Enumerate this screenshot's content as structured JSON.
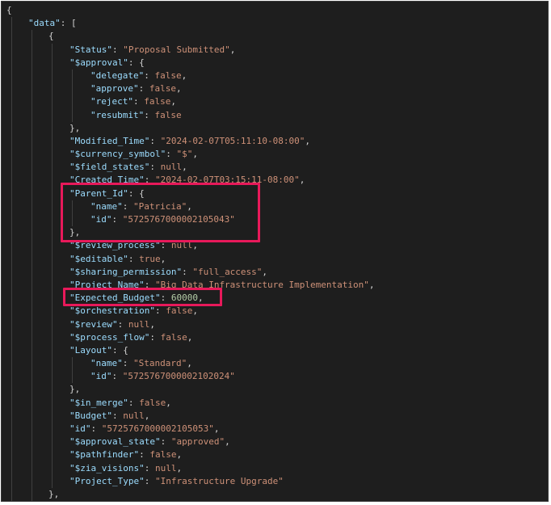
{
  "editor": {
    "lines": [
      {
        "indent": 0,
        "tokens": [
          {
            "t": "{",
            "c": "punc"
          }
        ]
      },
      {
        "indent": 1,
        "tokens": [
          {
            "t": "\"data\"",
            "c": "key"
          },
          {
            "t": ": [",
            "c": "punc"
          }
        ]
      },
      {
        "indent": 2,
        "tokens": [
          {
            "t": "{",
            "c": "punc"
          }
        ]
      },
      {
        "indent": 3,
        "tokens": [
          {
            "t": "\"Status\"",
            "c": "key"
          },
          {
            "t": ": ",
            "c": "punc"
          },
          {
            "t": "\"Proposal Submitted\"",
            "c": "str"
          },
          {
            "t": ",",
            "c": "punc"
          }
        ]
      },
      {
        "indent": 3,
        "tokens": [
          {
            "t": "\"$approval\"",
            "c": "key"
          },
          {
            "t": ": {",
            "c": "punc"
          }
        ]
      },
      {
        "indent": 4,
        "tokens": [
          {
            "t": "\"delegate\"",
            "c": "key"
          },
          {
            "t": ": ",
            "c": "punc"
          },
          {
            "t": "false",
            "c": "kw"
          },
          {
            "t": ",",
            "c": "punc"
          }
        ]
      },
      {
        "indent": 4,
        "tokens": [
          {
            "t": "\"approve\"",
            "c": "key"
          },
          {
            "t": ": ",
            "c": "punc"
          },
          {
            "t": "false",
            "c": "kw"
          },
          {
            "t": ",",
            "c": "punc"
          }
        ]
      },
      {
        "indent": 4,
        "tokens": [
          {
            "t": "\"reject\"",
            "c": "key"
          },
          {
            "t": ": ",
            "c": "punc"
          },
          {
            "t": "false",
            "c": "kw"
          },
          {
            "t": ",",
            "c": "punc"
          }
        ]
      },
      {
        "indent": 4,
        "tokens": [
          {
            "t": "\"resubmit\"",
            "c": "key"
          },
          {
            "t": ": ",
            "c": "punc"
          },
          {
            "t": "false",
            "c": "kw"
          }
        ]
      },
      {
        "indent": 3,
        "tokens": [
          {
            "t": "},",
            "c": "punc"
          }
        ]
      },
      {
        "indent": 3,
        "tokens": [
          {
            "t": "\"Modified_Time\"",
            "c": "key"
          },
          {
            "t": ": ",
            "c": "punc"
          },
          {
            "t": "\"2024-02-07T05:11:10-08:00\"",
            "c": "str"
          },
          {
            "t": ",",
            "c": "punc"
          }
        ]
      },
      {
        "indent": 3,
        "tokens": [
          {
            "t": "\"$currency_symbol\"",
            "c": "key"
          },
          {
            "t": ": ",
            "c": "punc"
          },
          {
            "t": "\"$\"",
            "c": "str"
          },
          {
            "t": ",",
            "c": "punc"
          }
        ]
      },
      {
        "indent": 3,
        "tokens": [
          {
            "t": "\"$field_states\"",
            "c": "key"
          },
          {
            "t": ": ",
            "c": "punc"
          },
          {
            "t": "null",
            "c": "kw"
          },
          {
            "t": ",",
            "c": "punc"
          }
        ]
      },
      {
        "indent": 3,
        "tokens": [
          {
            "t": "\"Created_Time\"",
            "c": "key"
          },
          {
            "t": ": ",
            "c": "punc"
          },
          {
            "t": "\"2024-02-07T03:15:11-08:00\"",
            "c": "str"
          },
          {
            "t": ",",
            "c": "punc"
          }
        ]
      },
      {
        "indent": 3,
        "tokens": [
          {
            "t": "\"Parent_Id\"",
            "c": "key"
          },
          {
            "t": ": {",
            "c": "punc"
          }
        ]
      },
      {
        "indent": 4,
        "tokens": [
          {
            "t": "\"name\"",
            "c": "key"
          },
          {
            "t": ": ",
            "c": "punc"
          },
          {
            "t": "\"Patricia\"",
            "c": "str"
          },
          {
            "t": ",",
            "c": "punc"
          }
        ]
      },
      {
        "indent": 4,
        "tokens": [
          {
            "t": "\"id\"",
            "c": "key"
          },
          {
            "t": ": ",
            "c": "punc"
          },
          {
            "t": "\"5725767000002105043\"",
            "c": "str"
          }
        ]
      },
      {
        "indent": 3,
        "tokens": [
          {
            "t": "},",
            "c": "punc"
          }
        ]
      },
      {
        "indent": 3,
        "tokens": [
          {
            "t": "\"$review_process\"",
            "c": "key"
          },
          {
            "t": ": ",
            "c": "punc"
          },
          {
            "t": "null",
            "c": "kw"
          },
          {
            "t": ",",
            "c": "punc"
          }
        ]
      },
      {
        "indent": 3,
        "tokens": [
          {
            "t": "\"$editable\"",
            "c": "key"
          },
          {
            "t": ": ",
            "c": "punc"
          },
          {
            "t": "true",
            "c": "kw"
          },
          {
            "t": ",",
            "c": "punc"
          }
        ]
      },
      {
        "indent": 3,
        "tokens": [
          {
            "t": "\"$sharing_permission\"",
            "c": "key"
          },
          {
            "t": ": ",
            "c": "punc"
          },
          {
            "t": "\"full_access\"",
            "c": "str"
          },
          {
            "t": ",",
            "c": "punc"
          }
        ]
      },
      {
        "indent": 3,
        "tokens": [
          {
            "t": "\"Project_Name\"",
            "c": "key"
          },
          {
            "t": ": ",
            "c": "punc"
          },
          {
            "t": "\"Big Data Infrastructure Implementation\"",
            "c": "str"
          },
          {
            "t": ",",
            "c": "punc"
          }
        ]
      },
      {
        "indent": 3,
        "tokens": [
          {
            "t": "\"Expected_Budget\"",
            "c": "key"
          },
          {
            "t": ": ",
            "c": "punc"
          },
          {
            "t": "60000",
            "c": "num"
          },
          {
            "t": ",",
            "c": "punc"
          }
        ]
      },
      {
        "indent": 3,
        "tokens": [
          {
            "t": "\"$orchestration\"",
            "c": "key"
          },
          {
            "t": ": ",
            "c": "punc"
          },
          {
            "t": "false",
            "c": "kw"
          },
          {
            "t": ",",
            "c": "punc"
          }
        ]
      },
      {
        "indent": 3,
        "tokens": [
          {
            "t": "\"$review\"",
            "c": "key"
          },
          {
            "t": ": ",
            "c": "punc"
          },
          {
            "t": "null",
            "c": "kw"
          },
          {
            "t": ",",
            "c": "punc"
          }
        ]
      },
      {
        "indent": 3,
        "tokens": [
          {
            "t": "\"$process_flow\"",
            "c": "key"
          },
          {
            "t": ": ",
            "c": "punc"
          },
          {
            "t": "false",
            "c": "kw"
          },
          {
            "t": ",",
            "c": "punc"
          }
        ]
      },
      {
        "indent": 3,
        "tokens": [
          {
            "t": "\"Layout\"",
            "c": "key"
          },
          {
            "t": ": {",
            "c": "punc"
          }
        ]
      },
      {
        "indent": 4,
        "tokens": [
          {
            "t": "\"name\"",
            "c": "key"
          },
          {
            "t": ": ",
            "c": "punc"
          },
          {
            "t": "\"Standard\"",
            "c": "str"
          },
          {
            "t": ",",
            "c": "punc"
          }
        ]
      },
      {
        "indent": 4,
        "tokens": [
          {
            "t": "\"id\"",
            "c": "key"
          },
          {
            "t": ": ",
            "c": "punc"
          },
          {
            "t": "\"5725767000002102024\"",
            "c": "str"
          }
        ]
      },
      {
        "indent": 3,
        "tokens": [
          {
            "t": "},",
            "c": "punc"
          }
        ]
      },
      {
        "indent": 3,
        "tokens": [
          {
            "t": "\"$in_merge\"",
            "c": "key"
          },
          {
            "t": ": ",
            "c": "punc"
          },
          {
            "t": "false",
            "c": "kw"
          },
          {
            "t": ",",
            "c": "punc"
          }
        ]
      },
      {
        "indent": 3,
        "tokens": [
          {
            "t": "\"Budget\"",
            "c": "key"
          },
          {
            "t": ": ",
            "c": "punc"
          },
          {
            "t": "null",
            "c": "kw"
          },
          {
            "t": ",",
            "c": "punc"
          }
        ]
      },
      {
        "indent": 3,
        "tokens": [
          {
            "t": "\"id\"",
            "c": "key"
          },
          {
            "t": ": ",
            "c": "punc"
          },
          {
            "t": "\"5725767000002105053\"",
            "c": "str"
          },
          {
            "t": ",",
            "c": "punc"
          }
        ]
      },
      {
        "indent": 3,
        "tokens": [
          {
            "t": "\"$approval_state\"",
            "c": "key"
          },
          {
            "t": ": ",
            "c": "punc"
          },
          {
            "t": "\"approved\"",
            "c": "str"
          },
          {
            "t": ",",
            "c": "punc"
          }
        ]
      },
      {
        "indent": 3,
        "tokens": [
          {
            "t": "\"$pathfinder\"",
            "c": "key"
          },
          {
            "t": ": ",
            "c": "punc"
          },
          {
            "t": "false",
            "c": "kw"
          },
          {
            "t": ",",
            "c": "punc"
          }
        ]
      },
      {
        "indent": 3,
        "tokens": [
          {
            "t": "\"$zia_visions\"",
            "c": "key"
          },
          {
            "t": ": ",
            "c": "punc"
          },
          {
            "t": "null",
            "c": "kw"
          },
          {
            "t": ",",
            "c": "punc"
          }
        ]
      },
      {
        "indent": 3,
        "tokens": [
          {
            "t": "\"Project_Type\"",
            "c": "key"
          },
          {
            "t": ": ",
            "c": "punc"
          },
          {
            "t": "\"Infrastructure Upgrade\"",
            "c": "str"
          }
        ]
      },
      {
        "indent": 2,
        "tokens": [
          {
            "t": "},",
            "c": "punc"
          }
        ]
      }
    ]
  },
  "colors": {
    "background": "#1e1e1e",
    "key": "#9cdcfe",
    "string": "#ce9178",
    "number": "#b5cea8",
    "highlight": "#e8195a"
  }
}
